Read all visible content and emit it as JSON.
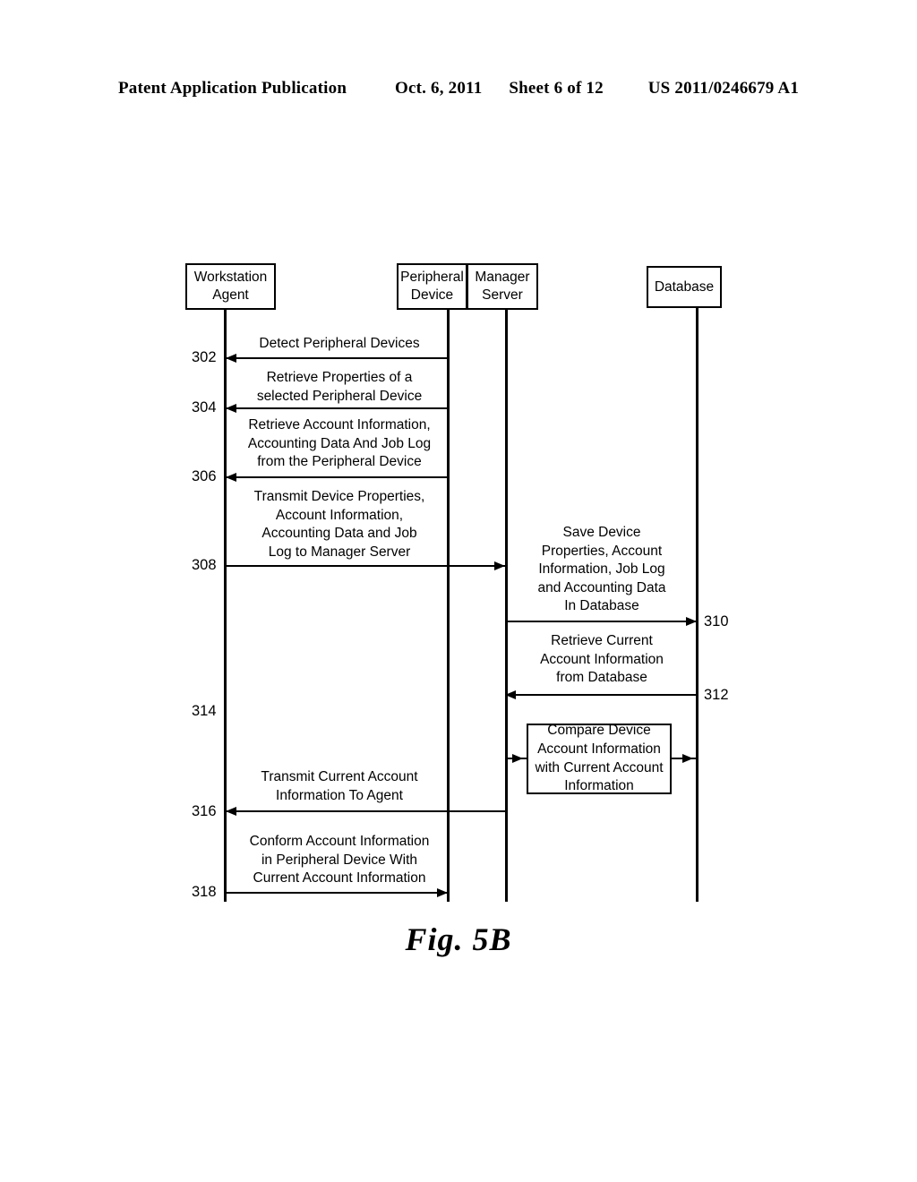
{
  "header": {
    "publication": "Patent Application Publication",
    "date": "Oct. 6, 2011",
    "sheet": "Sheet 6 of 12",
    "number": "US 2011/0246679 A1"
  },
  "figure": {
    "caption": "Fig. 5B",
    "type": "sequence-diagram"
  },
  "actors": [
    {
      "id": "workstation-agent",
      "line1": "Workstation",
      "line2": "Agent"
    },
    {
      "id": "peripheral-device",
      "line1": "Peripheral",
      "line2": "Device"
    },
    {
      "id": "manager-server",
      "line1": "Manager",
      "line2": "Server"
    },
    {
      "id": "database",
      "line1": "Database",
      "line2": ""
    }
  ],
  "messages": [
    {
      "ref": "302",
      "label": "Detect Peripheral Devices",
      "from": "peripheral-device",
      "to": "workstation-agent",
      "direction": "left"
    },
    {
      "ref": "304",
      "label": "Retrieve Properties of a\nselected Peripheral Device",
      "from": "peripheral-device",
      "to": "workstation-agent",
      "direction": "left"
    },
    {
      "ref": "306",
      "label": "Retrieve Account Information,\nAccounting Data And Job Log\nfrom the Peripheral Device",
      "from": "peripheral-device",
      "to": "workstation-agent",
      "direction": "left"
    },
    {
      "ref": "308",
      "label": "Transmit Device Properties,\nAccount Information,\nAccounting Data and Job\nLog to Manager Server",
      "from": "workstation-agent",
      "to": "manager-server",
      "direction": "right"
    },
    {
      "ref": "310",
      "label": "Save Device\nProperties,  Account\nInformation, Job Log\nand Accounting Data\nIn Database",
      "from": "manager-server",
      "to": "database",
      "direction": "right"
    },
    {
      "ref": "312",
      "label": "Retrieve Current\nAccount Information\nfrom Database",
      "from": "database",
      "to": "manager-server",
      "direction": "left"
    },
    {
      "ref": "314",
      "label": "",
      "from": "",
      "to": "",
      "direction": "none"
    },
    {
      "ref": "316",
      "label": "Transmit Current Account\nInformation To Agent",
      "from": "manager-server",
      "to": "workstation-agent",
      "direction": "left"
    },
    {
      "ref": "318",
      "label": "Conform Account Information\nin Peripheral Device With\nCurrent Account Information",
      "from": "workstation-agent",
      "to": "peripheral-device",
      "direction": "right"
    }
  ],
  "process_blocks": [
    {
      "id": "compare-account-information",
      "label": "Compare Device\nAccount Information\nwith Current Account\nInformation"
    }
  ]
}
